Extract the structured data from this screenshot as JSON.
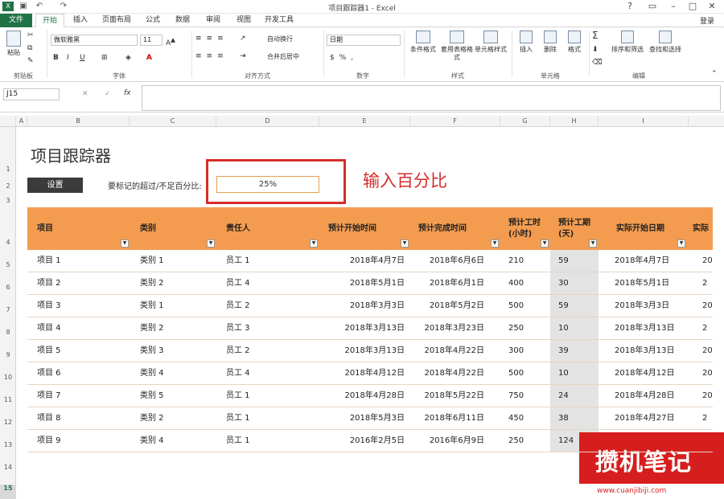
{
  "window": {
    "title": "项目跟踪器1 - Excel",
    "login": "登录"
  },
  "tabs": [
    "文件",
    "开始",
    "插入",
    "页面布局",
    "公式",
    "数据",
    "审阅",
    "视图",
    "开发工具"
  ],
  "ribbon": {
    "paste": "粘贴",
    "clipboard_group": "剪贴板",
    "font_name": "微软雅黑",
    "font_size": "11",
    "font_group": "字体",
    "wrap": "自动换行",
    "merge": "合并后居中",
    "align_group": "对齐方式",
    "number_format": "日期",
    "number_group": "数字",
    "cond_format": "条件格式",
    "table_format": "套用表格格式",
    "cell_style": "单元格样式",
    "styles_group": "样式",
    "insert": "插入",
    "delete": "删除",
    "format": "格式",
    "cells_group": "单元格",
    "sort_filter": "排序和筛选",
    "find_select": "查找和选择",
    "edit_group": "编辑"
  },
  "formula_bar": {
    "name_box": "J15",
    "fx": "fx",
    "value": ""
  },
  "columns": [
    "A",
    "B",
    "C",
    "D",
    "E",
    "F",
    "G",
    "H",
    "I"
  ],
  "rows": [
    "1",
    "2",
    "3",
    "4",
    "5",
    "6",
    "7",
    "8",
    "9",
    "10",
    "11",
    "12",
    "13",
    "14",
    "15"
  ],
  "sheet": {
    "title": "项目跟踪器",
    "settings_button": "设置",
    "percent_label": "要标记的超过/不足百分比:",
    "percent_value": "25%",
    "annotation": "输入百分比",
    "headers": [
      "项目",
      "类别",
      "责任人",
      "预计开始时间",
      "预计完成时间",
      "预计工时(小时)",
      "预计工期(天)",
      "实际开始日期",
      "实际"
    ],
    "table": [
      [
        "项目 1",
        "类别 1",
        "员工 1",
        "2018年4月7日",
        "2018年6月6日",
        "210",
        "59",
        "2018年4月7日",
        "20"
      ],
      [
        "项目 2",
        "类别 2",
        "员工 4",
        "2018年5月1日",
        "2018年6月1日",
        "400",
        "30",
        "2018年5月1日",
        "2"
      ],
      [
        "项目 3",
        "类别 1",
        "员工 2",
        "2018年3月3日",
        "2018年5月2日",
        "500",
        "59",
        "2018年3月3日",
        "20"
      ],
      [
        "项目 4",
        "类别 2",
        "员工 3",
        "2018年3月13日",
        "2018年3月23日",
        "250",
        "10",
        "2018年3月13日",
        "2"
      ],
      [
        "项目 5",
        "类别 3",
        "员工 2",
        "2018年3月13日",
        "2018年4月22日",
        "300",
        "39",
        "2018年3月13日",
        "20"
      ],
      [
        "项目 6",
        "类别 4",
        "员工 4",
        "2018年4月12日",
        "2018年4月22日",
        "500",
        "10",
        "2018年4月12日",
        "20"
      ],
      [
        "项目 7",
        "类别 5",
        "员工 1",
        "2018年4月28日",
        "2018年5月22日",
        "750",
        "24",
        "2018年4月28日",
        "20"
      ],
      [
        "项目 8",
        "类别 2",
        "员工 1",
        "2018年5月3日",
        "2018年6月11日",
        "450",
        "38",
        "2018年4月27日",
        "2"
      ],
      [
        "项目 9",
        "类别 4",
        "员工 1",
        "2016年2月5日",
        "2016年6月9日",
        "250",
        "124",
        "",
        ""
      ]
    ]
  },
  "watermark": {
    "text": "攒机笔记",
    "url": "www.cuanjibiji.com"
  }
}
